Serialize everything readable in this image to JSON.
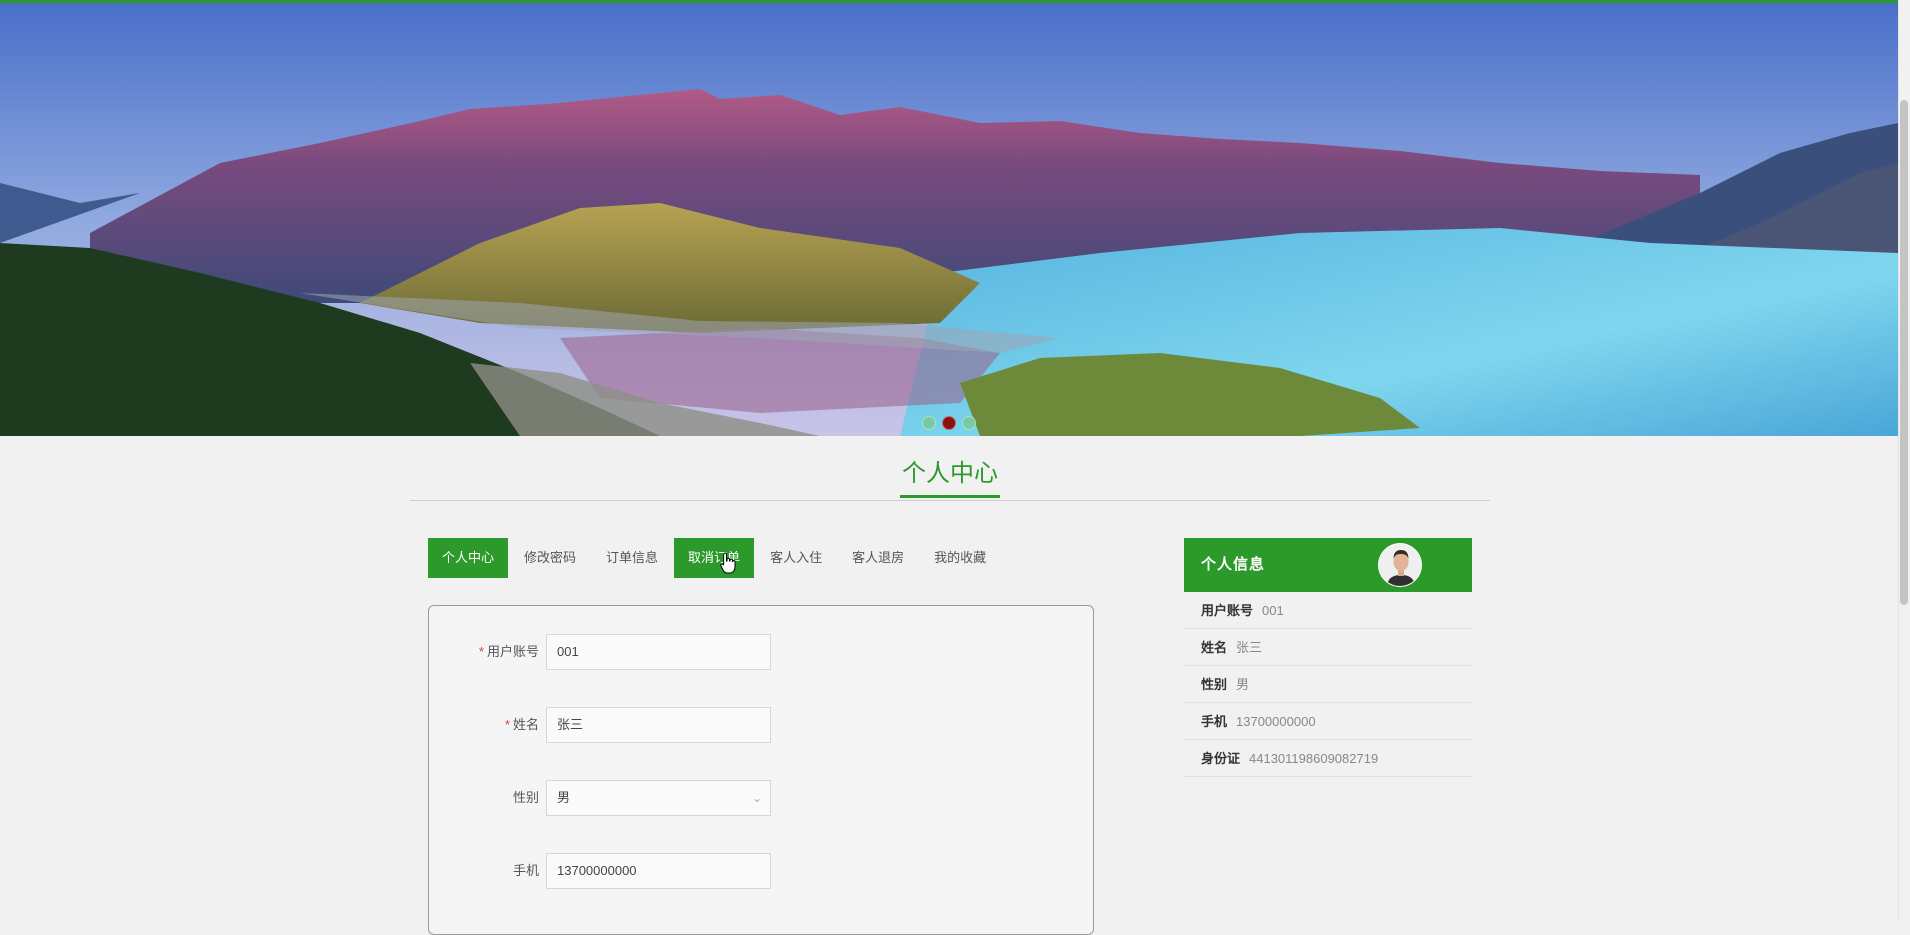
{
  "banner": {
    "slide_count": 3,
    "active_slide": 2
  },
  "section": {
    "title": "个人中心"
  },
  "tabs": [
    {
      "label": "个人中心",
      "active": true
    },
    {
      "label": "修改密码",
      "active": false
    },
    {
      "label": "订单信息",
      "active": false
    },
    {
      "label": "取消订单",
      "active": true
    },
    {
      "label": "客人入住",
      "active": false
    },
    {
      "label": "客人退房",
      "active": false
    },
    {
      "label": "我的收藏",
      "active": false
    }
  ],
  "form": {
    "account": {
      "label": "用户账号",
      "value": "001",
      "required": true
    },
    "name": {
      "label": "姓名",
      "value": "张三",
      "required": true
    },
    "gender": {
      "label": "性别",
      "value": "男",
      "required": false
    },
    "phone": {
      "label": "手机",
      "value": "13700000000",
      "required": false
    }
  },
  "info": {
    "title": "个人信息",
    "rows": [
      {
        "key": "用户账号",
        "value": "001"
      },
      {
        "key": "姓名",
        "value": "张三"
      },
      {
        "key": "性别",
        "value": "男"
      },
      {
        "key": "手机",
        "value": "13700000000"
      },
      {
        "key": "身份证",
        "value": "441301198609082719"
      }
    ]
  },
  "colors": {
    "accent": "#2b9a2b",
    "required": "#e03a3a",
    "active_dot": "#8b0f0f"
  }
}
